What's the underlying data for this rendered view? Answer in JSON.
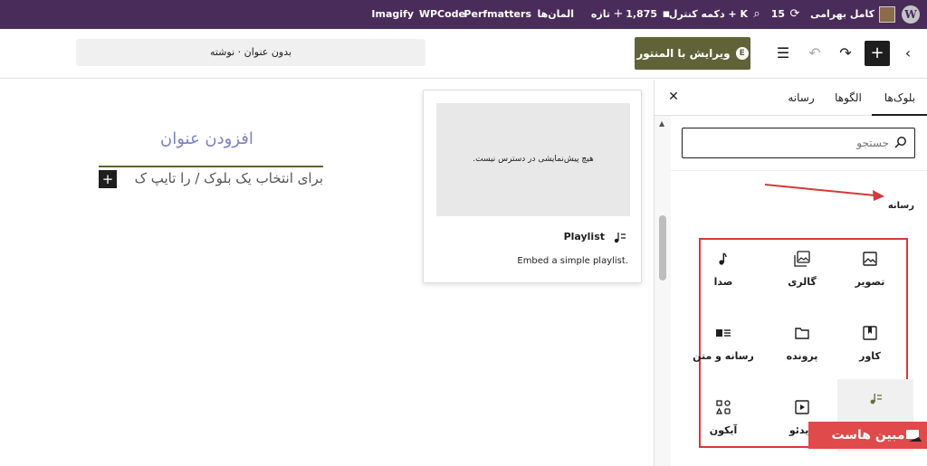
{
  "adminbar": {
    "wp_logo": "W",
    "user_name": "کامل بهرامی",
    "updates_count": "15",
    "search_label": "دکمه کنترل + K",
    "comments_count": "1,875",
    "new_label": "تازه",
    "elements_label": "المان‌ها",
    "plugins": [
      "Perfmatters",
      "WPCode",
      "Imagify"
    ]
  },
  "header": {
    "elementor_label": "ویرایش با المنتور",
    "doc_title": "بدون عنوان · نوشته"
  },
  "sidebar": {
    "tabs": [
      "بلوک‌ها",
      "الگوها",
      "رسانه"
    ],
    "close_icon": "close-icon",
    "search_placeholder": "جستجو",
    "media_heading": "رسانه",
    "blocks": [
      {
        "label": "تصویر",
        "icon": "image-icon"
      },
      {
        "label": "گالری",
        "icon": "gallery-icon"
      },
      {
        "label": "صدا",
        "icon": "audio-icon"
      },
      {
        "label": "کاور",
        "icon": "cover-icon"
      },
      {
        "label": "پرونده",
        "icon": "file-icon"
      },
      {
        "label": "رسانه و متن",
        "icon": "media-text-icon"
      },
      {
        "label": "",
        "icon": "playlist-icon"
      },
      {
        "label": "ویدئو",
        "icon": "video-icon"
      },
      {
        "label": "آیکون",
        "icon": "icons-icon"
      }
    ],
    "brand_label": "مبین هاست"
  },
  "preview": {
    "no_preview": "هیچ پیش‌نمایشی در دسترس نیست.",
    "title": "Playlist",
    "description": "Embed a simple playlist."
  },
  "editor": {
    "title_placeholder": "افزودن عنوان",
    "paragraph_placeholder": "برای انتخاب یک بلوک / را تایپ ک"
  },
  "colors": {
    "adminbar": "#4a2c5a",
    "elementor": "#5f6337",
    "highlight": "#d33a3a",
    "title_placeholder": "#7b80c7"
  }
}
